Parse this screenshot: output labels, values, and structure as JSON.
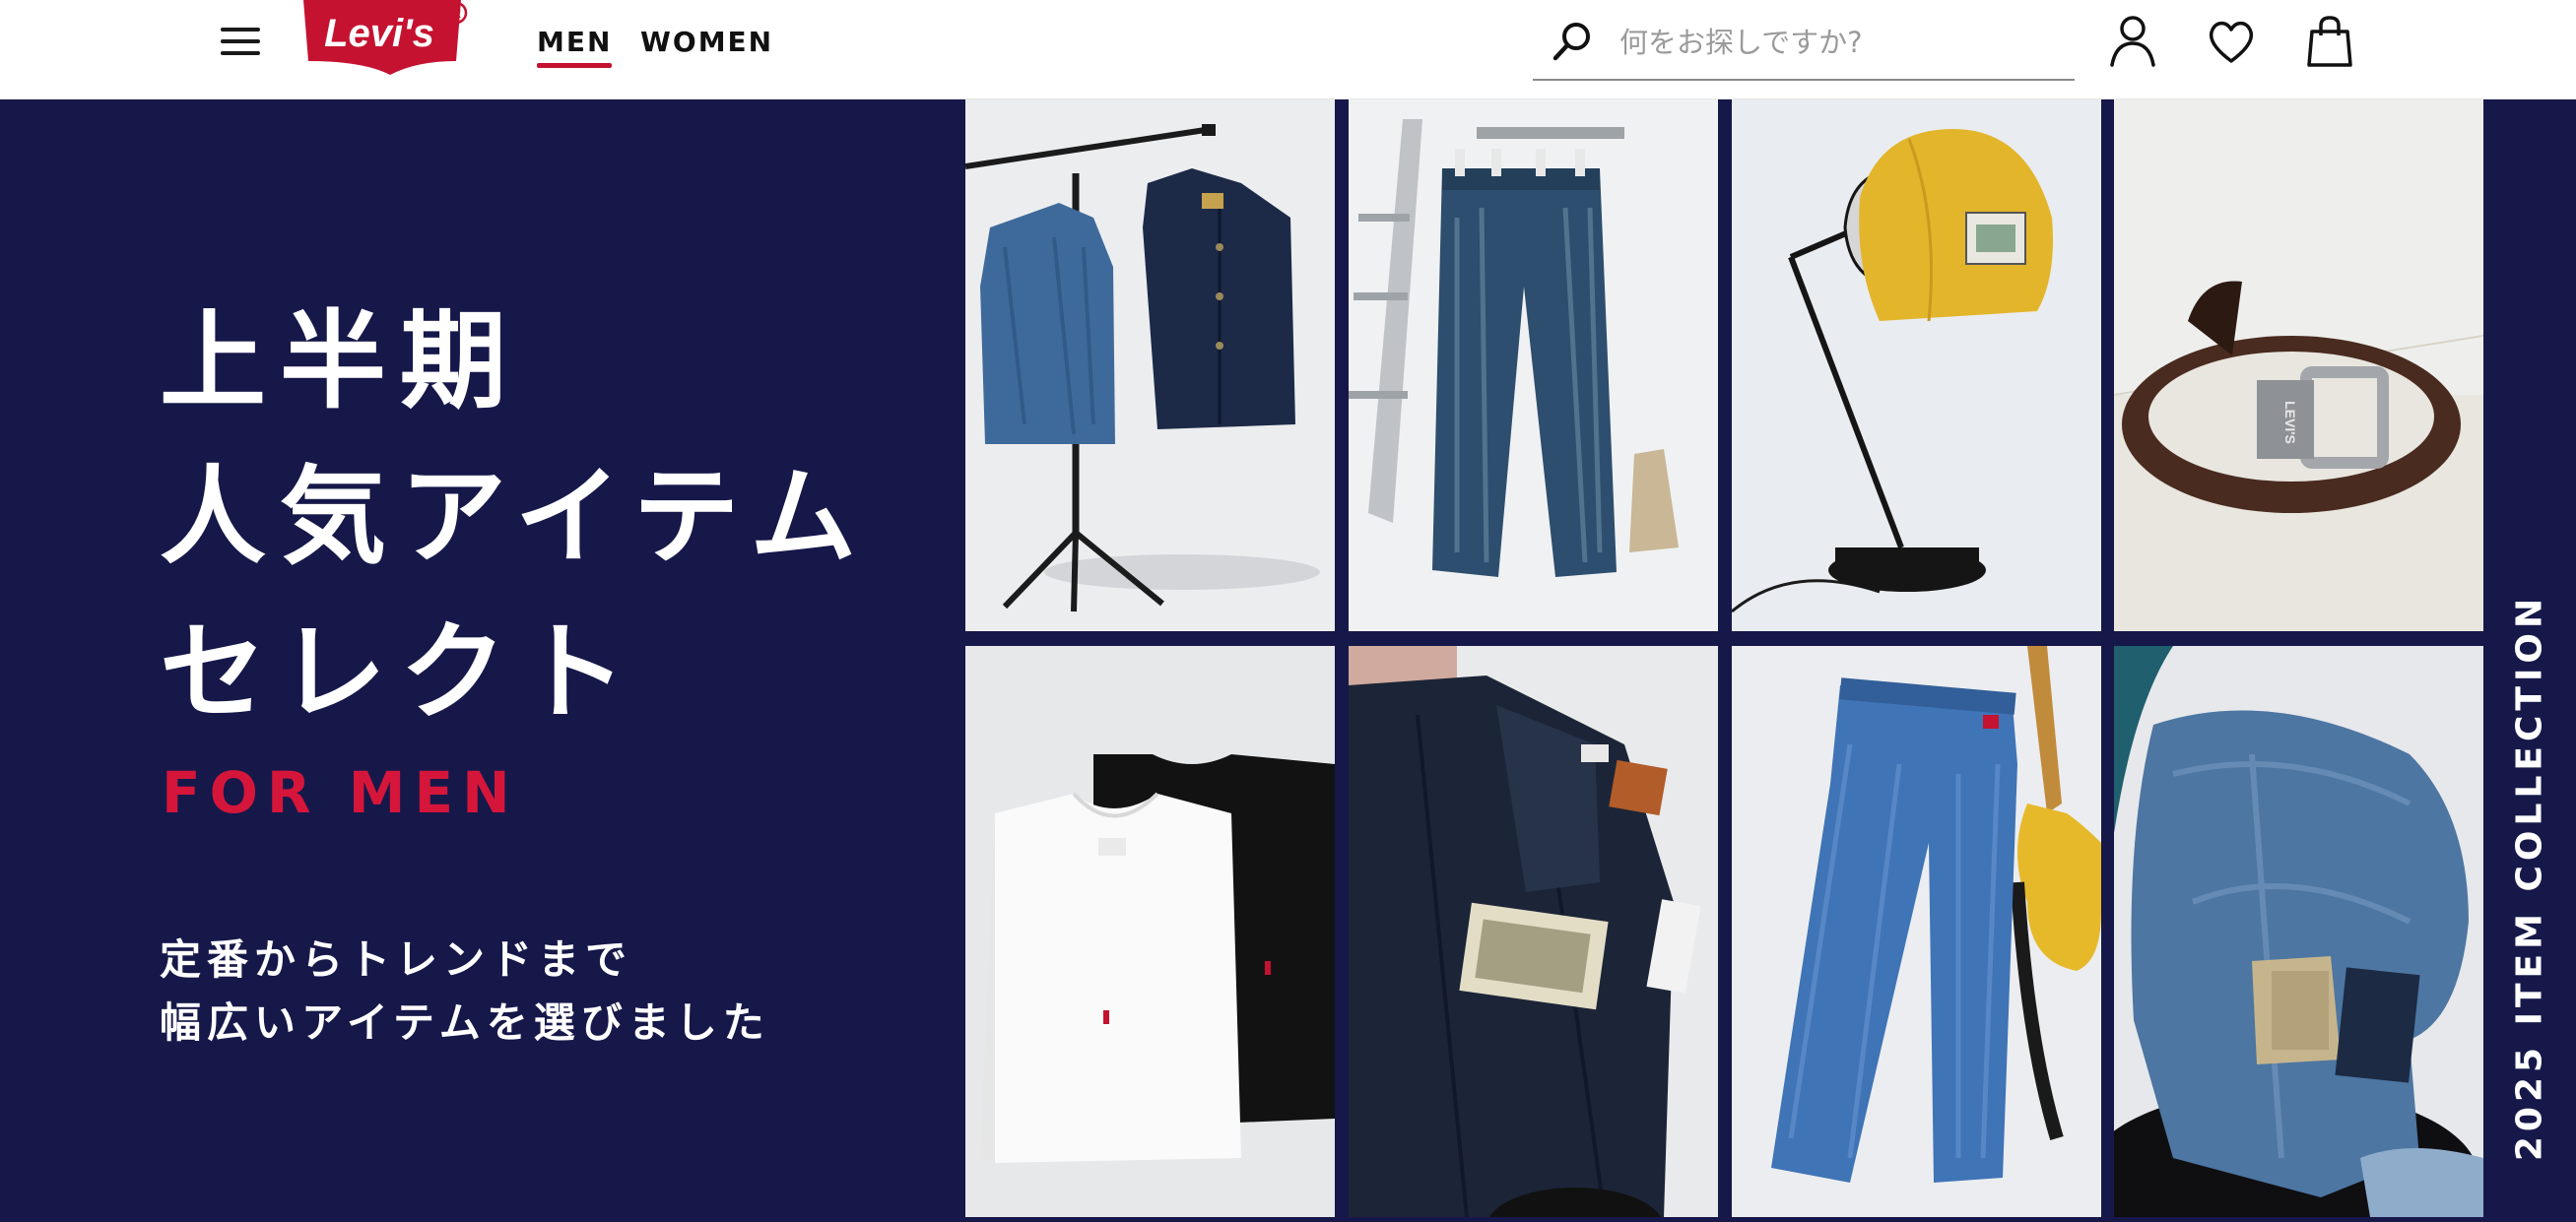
{
  "header": {
    "logo_text": "Levi's",
    "nav": [
      {
        "label": "MEN",
        "active": true
      },
      {
        "label": "WOMEN",
        "active": false
      }
    ],
    "search": {
      "placeholder": "何をお探しですか?",
      "value": ""
    },
    "icons": [
      "menu-icon",
      "search-icon",
      "account-icon",
      "heart-icon",
      "shopping-bag-icon"
    ]
  },
  "hero": {
    "headline_lines": [
      "上半期",
      "人気アイテム",
      "セレクト"
    ],
    "tagline": "FOR MEN",
    "subtext_lines": [
      "定番からトレンドまで",
      "幅広いアイテムを選びました"
    ],
    "vertical_label": "2025 ITEM COLLECTION",
    "products": [
      "denim-jacket-and-coat-on-rack",
      "wide-leg-jeans-on-ladder",
      "yellow-cap-on-desk-lamp",
      "brown-leather-belt",
      "white-and-black-t-shirts",
      "raw-denim-jeans-1922",
      "light-blue-jeans-with-guitar",
      "folded-jeans-on-stool"
    ]
  },
  "colors": {
    "hero_background": "#16184a",
    "accent_red": "#c41230",
    "for_men_red": "#d5163a",
    "logo_red": "#c41230"
  }
}
